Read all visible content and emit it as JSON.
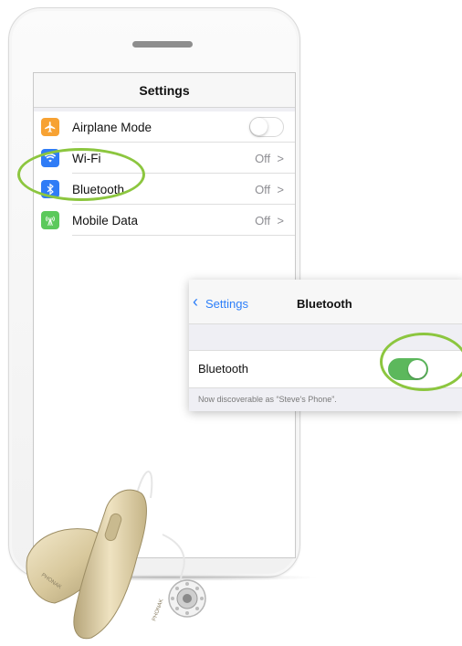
{
  "phone": {
    "screen": {
      "title": "Settings",
      "rows": [
        {
          "label": "Airplane Mode",
          "icon": "airplane-icon",
          "color": "#f7a233"
        },
        {
          "label": "Wi-Fi",
          "icon": "wifi-icon",
          "color": "#2f7cf6",
          "value": "Off",
          "chevron": ">"
        },
        {
          "label": "Bluetooth",
          "icon": "bluetooth-icon",
          "color": "#2f7cf6",
          "value": "Off",
          "chevron": ">"
        },
        {
          "label": "Mobile Data",
          "icon": "antenna-icon",
          "color": "#5bc95b",
          "value": "Off",
          "chevron": ">"
        }
      ]
    }
  },
  "popup": {
    "back_label": "Settings",
    "title": "Bluetooth",
    "row_label": "Bluetooth",
    "note": "Now discoverable as “Steve's Phone”.",
    "toggle_on": true
  },
  "device": {
    "brand": "PHONAK"
  },
  "colors": {
    "highlight": "#8cc63f",
    "ios_blue": "#2d7ff9",
    "toggle_green": "#5cb85c"
  }
}
